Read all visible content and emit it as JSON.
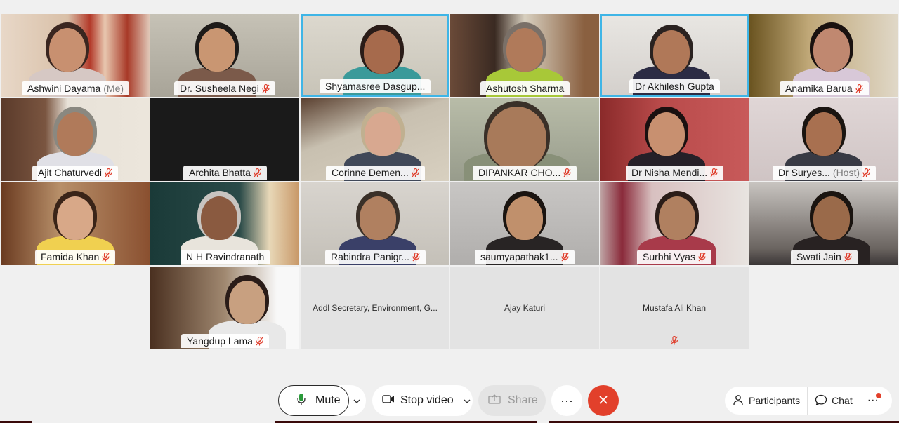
{
  "participants": [
    {
      "name": "Ashwini Dayama",
      "role": "(Me)",
      "muted": false,
      "active": false
    },
    {
      "name": "Dr. Susheela Negi",
      "role": "",
      "muted": true,
      "active": false
    },
    {
      "name": "Shyamasree Dasgup...",
      "role": "",
      "muted": false,
      "active": true
    },
    {
      "name": "Ashutosh Sharma",
      "role": "",
      "muted": false,
      "active": false
    },
    {
      "name": "Dr Akhilesh Gupta",
      "role": "",
      "muted": false,
      "active": true
    },
    {
      "name": "Anamika Barua",
      "role": "",
      "muted": true,
      "active": false
    },
    {
      "name": "Ajit Chaturvedi",
      "role": "",
      "muted": true,
      "active": false
    },
    {
      "name": "Archita Bhatta",
      "role": "",
      "muted": true,
      "active": false
    },
    {
      "name": "Corinne Demen...",
      "role": "",
      "muted": true,
      "active": false
    },
    {
      "name": "DIPANKAR CHO...",
      "role": "",
      "muted": true,
      "active": false
    },
    {
      "name": "Dr Nisha Mendi...",
      "role": "",
      "muted": true,
      "active": false
    },
    {
      "name": "Dr Suryes...",
      "role": "(Host)",
      "muted": true,
      "active": false
    },
    {
      "name": "Famida Khan",
      "role": "",
      "muted": true,
      "active": false
    },
    {
      "name": "N H Ravindranath",
      "role": "",
      "muted": false,
      "active": false
    },
    {
      "name": "Rabindra Panigr...",
      "role": "",
      "muted": true,
      "active": false
    },
    {
      "name": "saumyapathak1...",
      "role": "",
      "muted": true,
      "active": false
    },
    {
      "name": "Surbhi Vyas",
      "role": "",
      "muted": true,
      "active": false
    },
    {
      "name": "Swati Jain",
      "role": "",
      "muted": true,
      "active": false
    },
    {
      "name": "Yangdup Lama",
      "role": "",
      "muted": true,
      "active": false
    }
  ],
  "no_video": [
    {
      "name": "Addl Secretary, Environment, G...",
      "muted": false
    },
    {
      "name": "Ajay Katuri",
      "muted": false
    },
    {
      "name": "Mustafa Ali Khan",
      "muted": true
    }
  ],
  "controls": {
    "mute_label": "Mute",
    "video_label": "Stop video",
    "share_label": "Share",
    "more_label": "···",
    "participants_label": "Participants",
    "chat_label": "Chat",
    "right_more_label": "···"
  },
  "colors": {
    "accent_active_border": "#3fb5e6",
    "end_call": "#e2402b",
    "muted_icon": "#e0412f"
  },
  "icons": [
    "microphone-icon",
    "mic-muted-icon",
    "chevron-down-icon",
    "video-camera-icon",
    "share-screen-icon",
    "more-icon",
    "close-icon",
    "participants-icon",
    "chat-icon"
  ]
}
